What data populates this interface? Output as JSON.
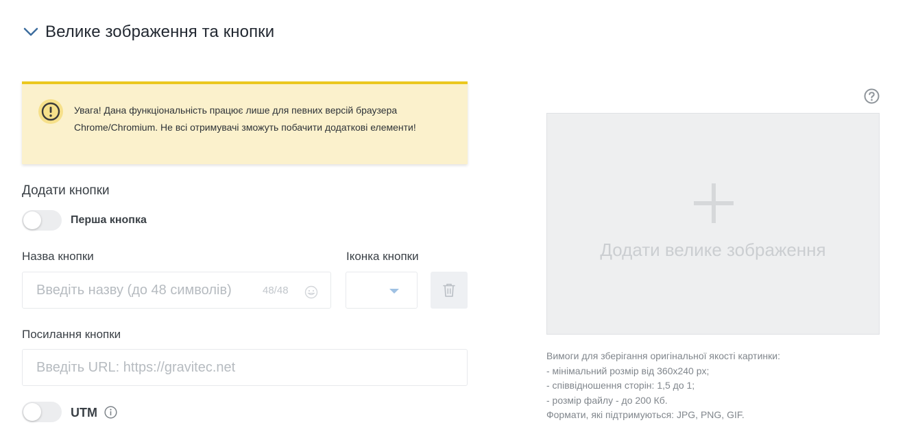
{
  "section": {
    "title": "Велике зображення та кнопки"
  },
  "warning": {
    "text": "Увага! Дана функціональність працює лише для певних версій браузера Chrome/Chromium. Не всі отримувачі зможуть побачити додаткові елементи!"
  },
  "buttons_section": {
    "title": "Додати кнопки",
    "first_button_toggle_label": "Перша кнопка",
    "first_button_toggle_on": false,
    "name_label": "Назва кнопки",
    "name_placeholder": "Введіть назву (до 48 символів)",
    "name_counter": "48/48",
    "icon_label": "Іконка кнопки",
    "url_label": "Посилання кнопки",
    "url_placeholder": "Введіть URL: https://gravitec.net",
    "utm_label": "UTM",
    "utm_toggle_on": false
  },
  "image_upload": {
    "label": "Додати велике зображення",
    "requirements": [
      "Вимоги для зберігання оригінальної якості картинки:",
      "- мінімальний розмір від 360х240 px;",
      "- співвідношення сторін: 1,5 до 1;",
      "- розмір файлу - до 200 Кб.",
      "Формати, які підтримуються: JPG, PNG, GIF."
    ]
  },
  "icons": {
    "collapse": "chevron-down-icon",
    "warning": "exclamation-circle-icon",
    "emoji": "emoji-icon",
    "caret": "caret-down-icon",
    "delete": "trash-icon",
    "help": "question-circle-icon",
    "info": "info-icon",
    "add": "plus-icon"
  },
  "colors": {
    "warning_bg": "#fbf1cc",
    "warning_border": "#ebc81e",
    "chevron": "#3d6d9e",
    "caret": "#9fc1e3"
  }
}
